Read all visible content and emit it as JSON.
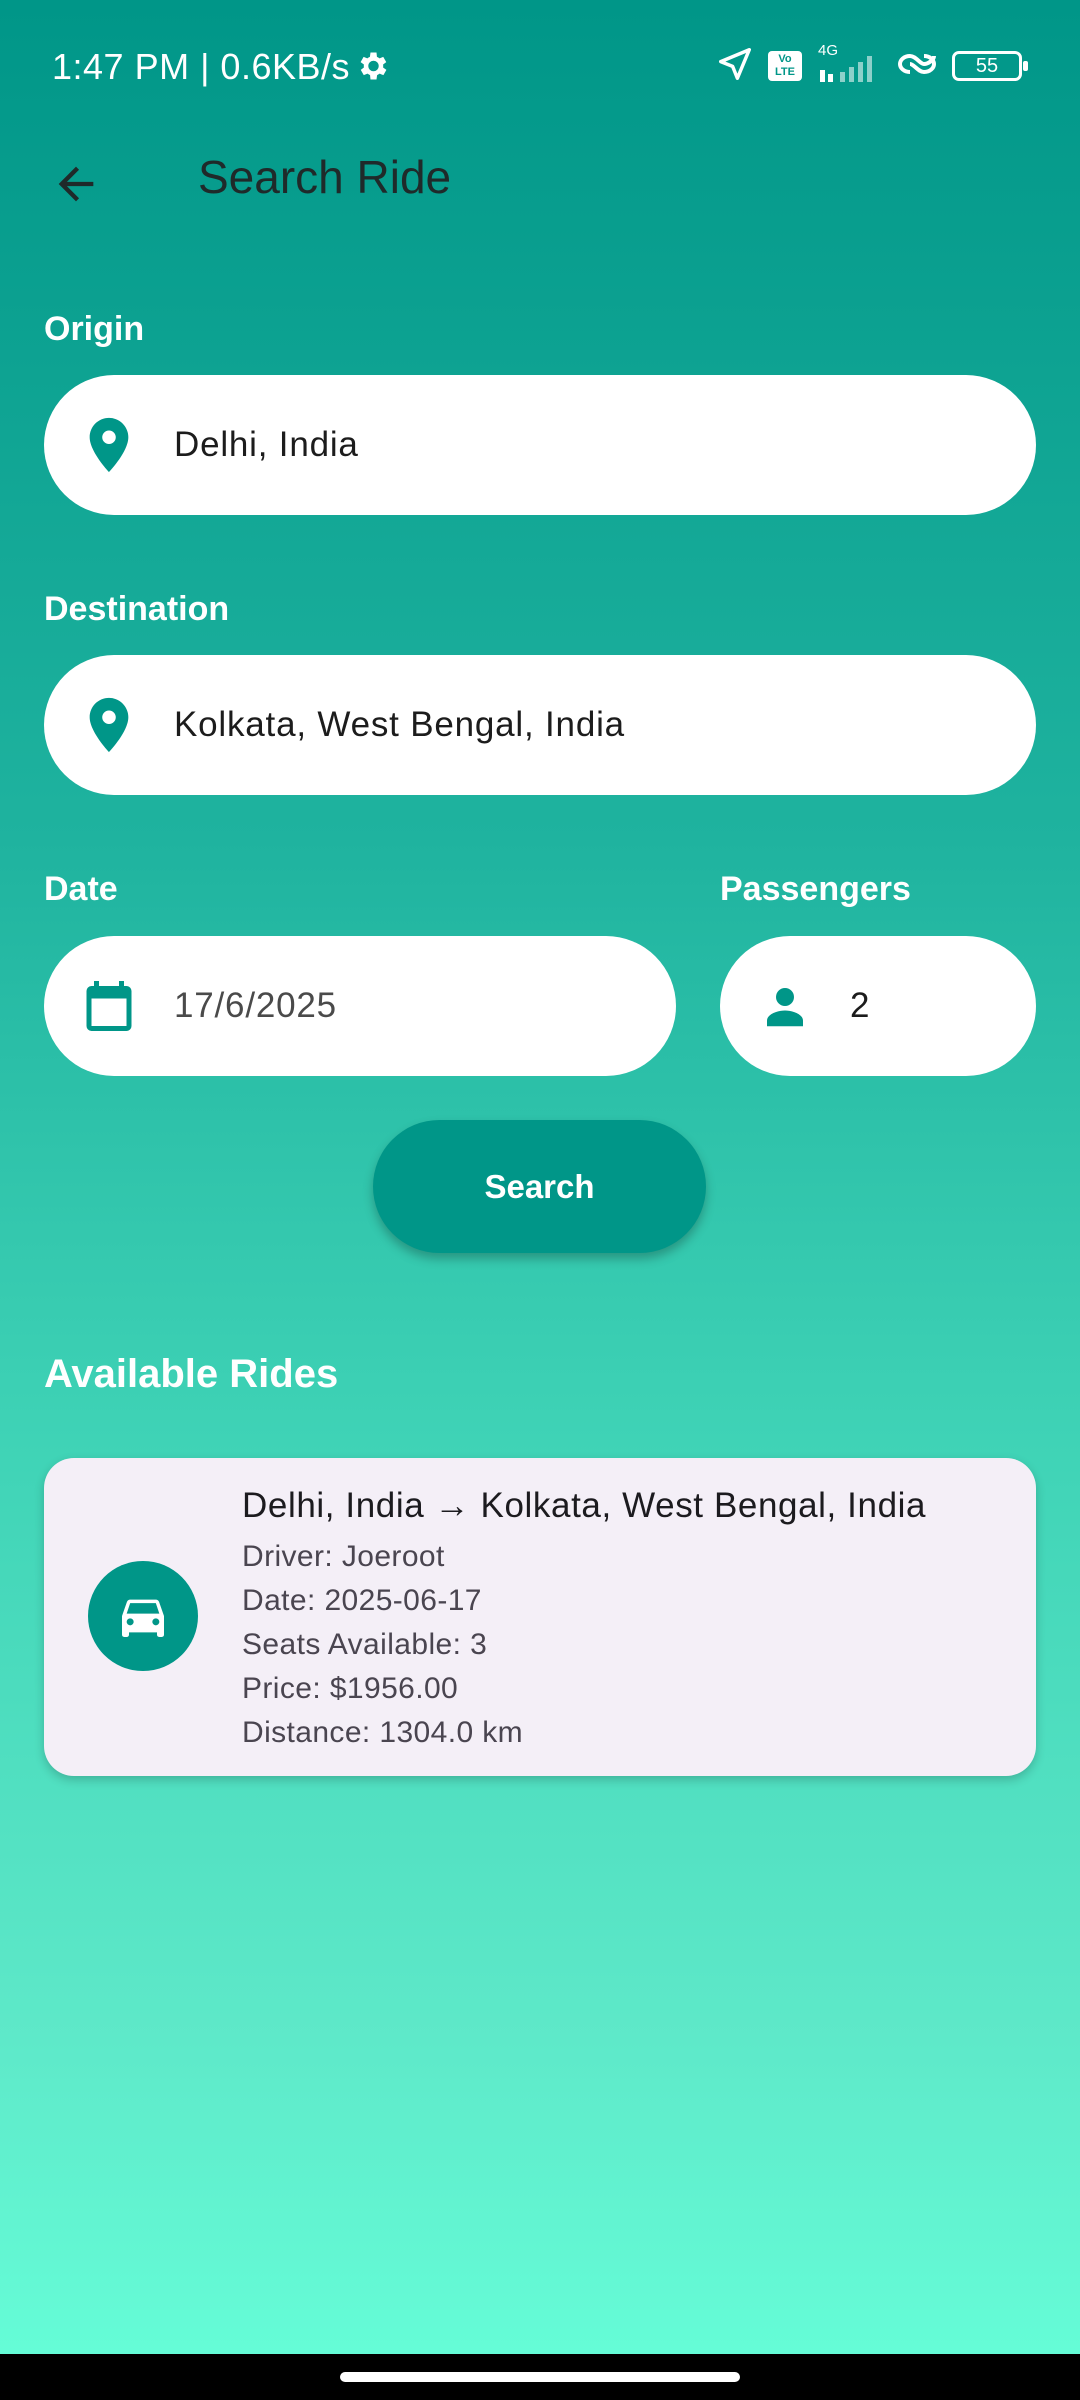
{
  "status_bar": {
    "time_speed": "1:47 PM | 0.6KB/s",
    "network": "4G",
    "volte": "Vo LTE",
    "battery": "55"
  },
  "appbar": {
    "title": "Search Ride"
  },
  "form": {
    "origin_label": "Origin",
    "origin_value": "Delhi, India",
    "destination_label": "Destination",
    "destination_value": "Kolkata, West Bengal, India",
    "date_label": "Date",
    "date_value": "17/6/2025",
    "passengers_label": "Passengers",
    "passengers_value": "2",
    "search_label": "Search"
  },
  "results": {
    "title": "Available Rides",
    "rides": [
      {
        "route": "Delhi, India → Kolkata, West Bengal, India",
        "driver": "Driver: Joeroot",
        "date": "Date: 2025-06-17",
        "seats": "Seats Available: 3",
        "price": "Price: $1956.00",
        "distance": "Distance: 1304.0 km"
      }
    ]
  },
  "colors": {
    "primary": "#009688",
    "card": "#f4eff7",
    "gradient_end": "#66ffd9"
  },
  "icons": [
    "gear-icon",
    "location-arrow-icon",
    "volte-icon",
    "signal-icon",
    "link-icon",
    "battery-icon",
    "back-arrow-icon",
    "location-pin-icon",
    "calendar-icon",
    "person-icon",
    "car-icon"
  ]
}
